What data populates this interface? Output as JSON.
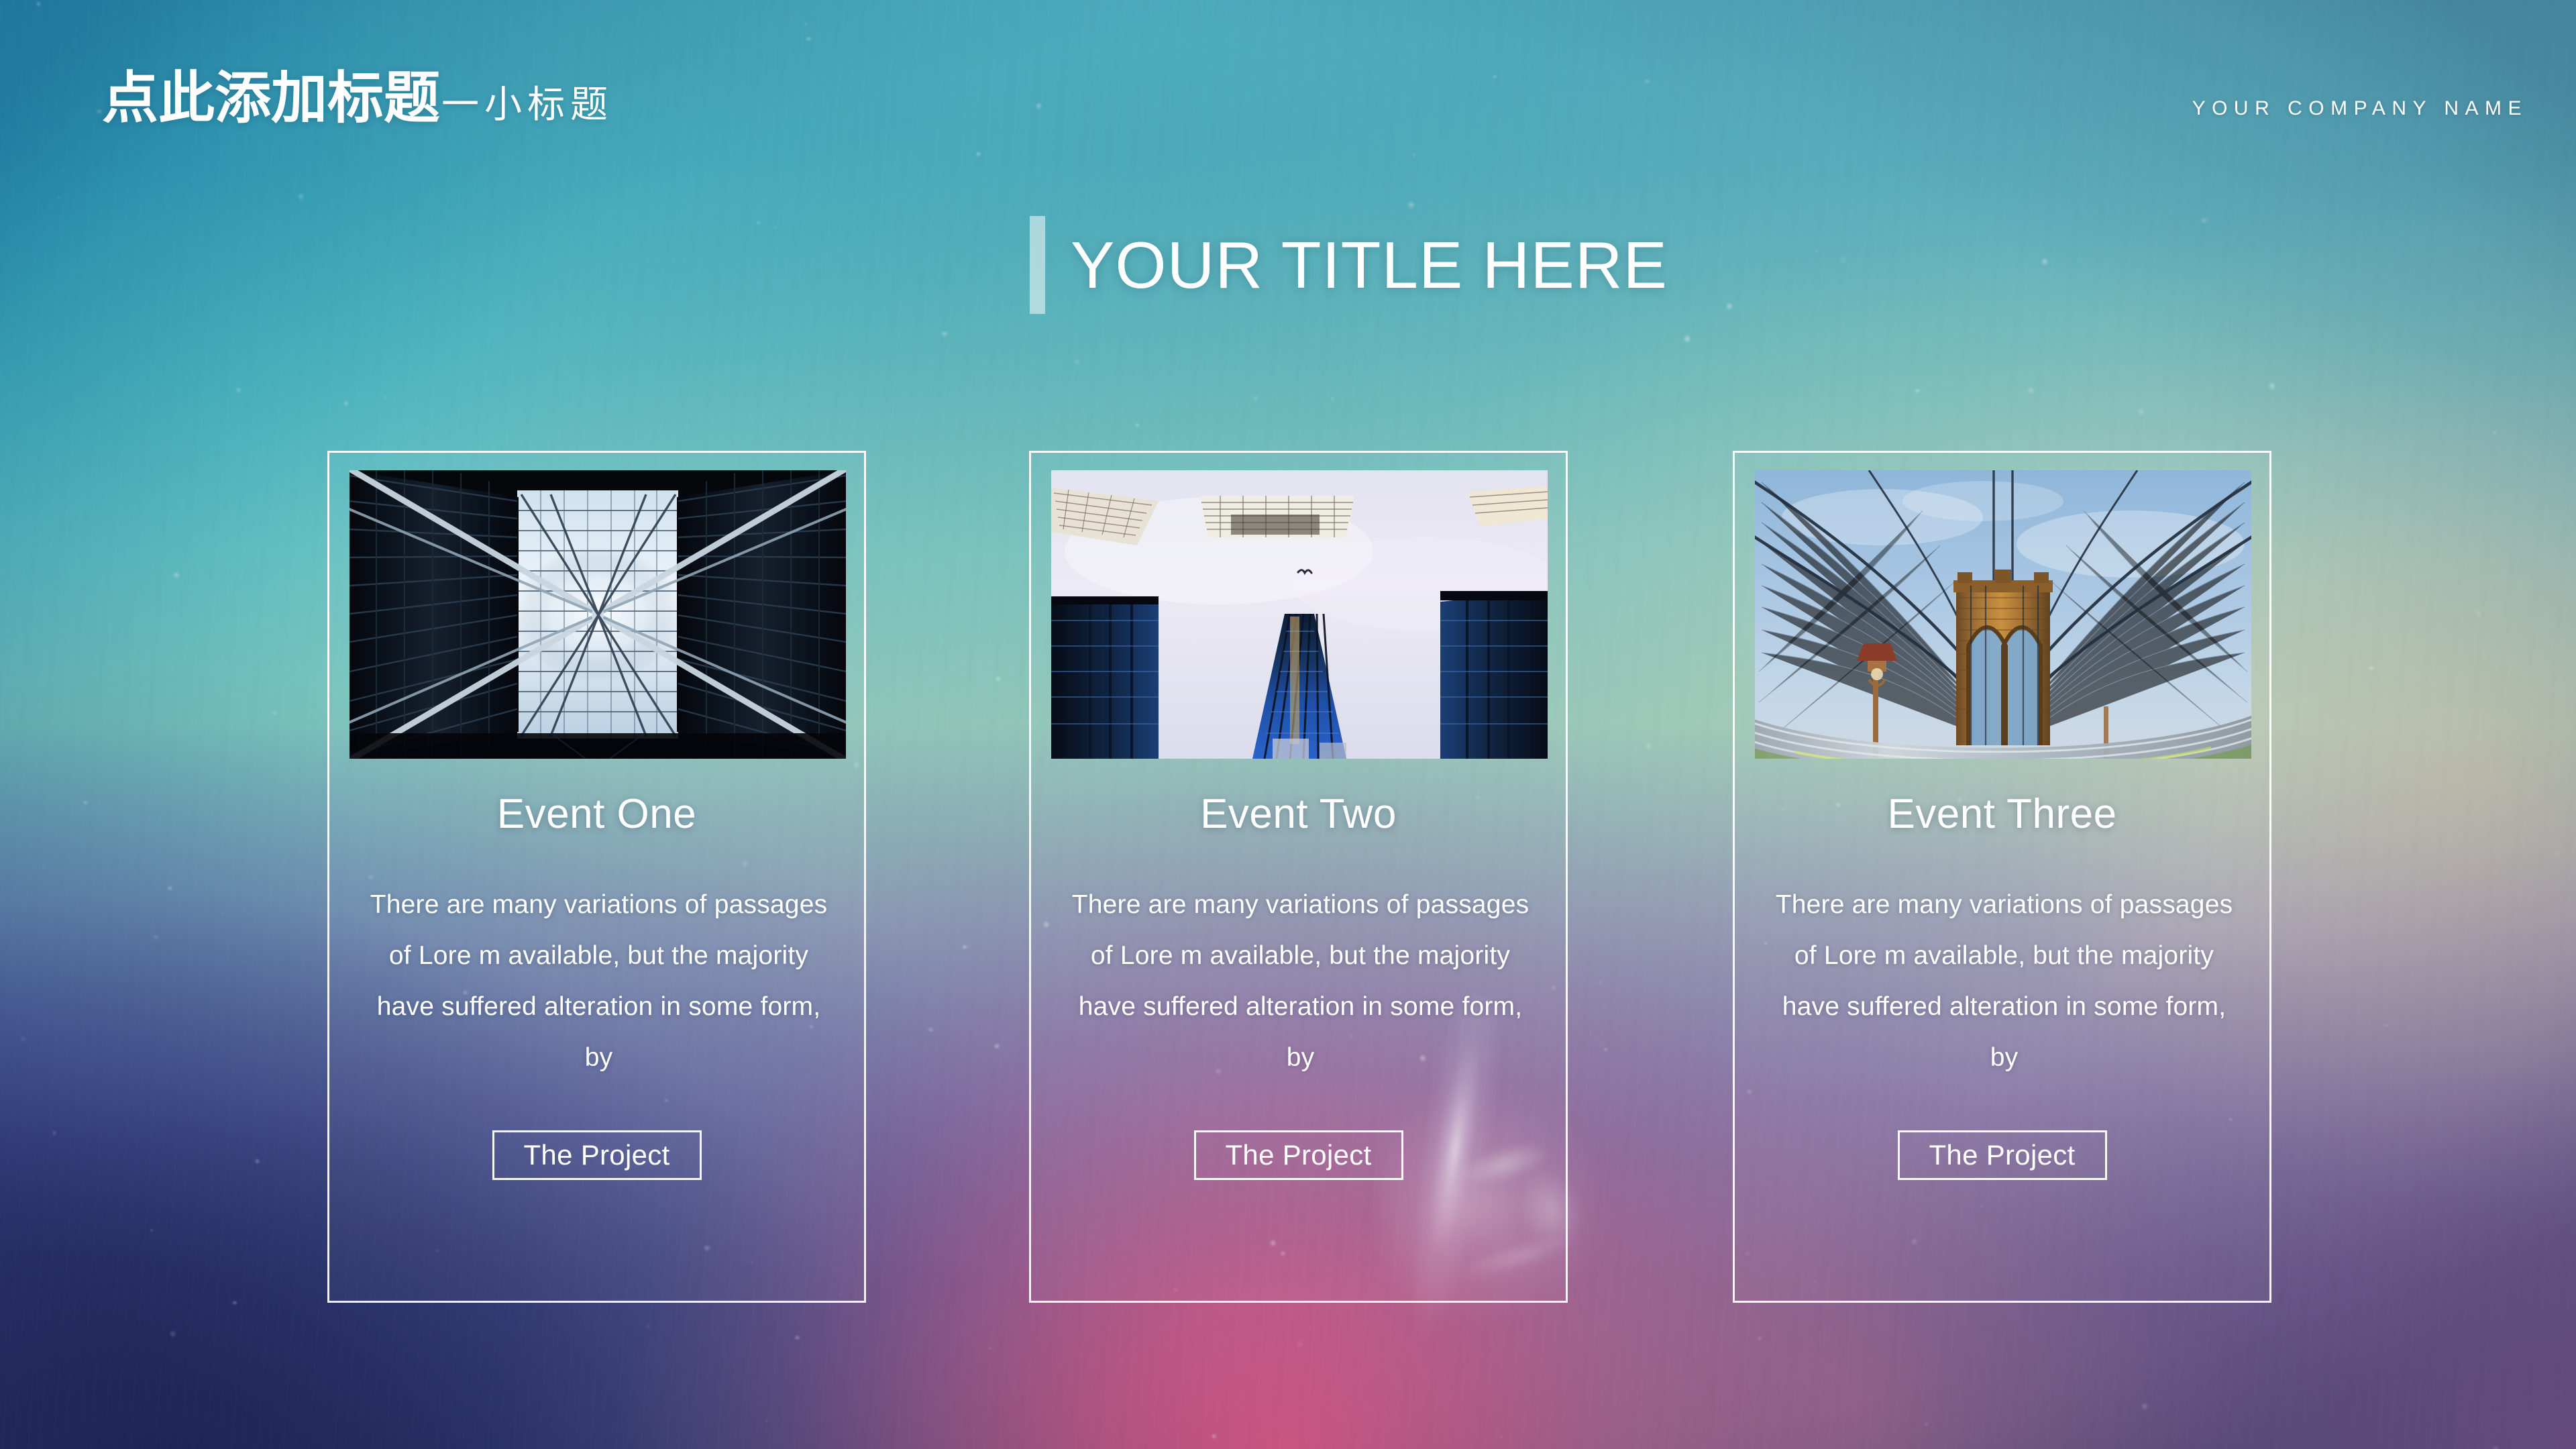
{
  "header": {
    "brand_main": "点此添加标题",
    "brand_sub": "一小标题",
    "company_name": "YOUR COMPANY NAME"
  },
  "section": {
    "title": "YOUR TITLE HERE"
  },
  "cards": [
    {
      "heading": "Event One",
      "body": "There are many variations of passages of Lore m available, but the majority have suffered alteration in some form, by",
      "button_label": "The Project",
      "image_alt": "glass-atrium-looking-up"
    },
    {
      "heading": "Event Two",
      "body": "There are many variations of passages of Lore m available, but the majority have suffered alteration in some form, by",
      "button_label": "The Project",
      "image_alt": "skyscrapers-looking-up"
    },
    {
      "heading": "Event Three",
      "body": "There are many variations of passages of Lore m available, but the majority have suffered alteration in some form, by",
      "button_label": "The Project",
      "image_alt": "brooklyn-bridge-cables"
    }
  ],
  "colors": {
    "text": "#ffffff",
    "bg_top_teal": "#49a6b9",
    "bg_left_navy": "#2a3272",
    "bg_center_rose": "#e0587f",
    "bg_right_mauve": "#8b6096",
    "bg_right_sand": "#dcc8a8",
    "card_border": "rgba(255,255,255,0.92)",
    "accent_bar": "rgba(255,255,255,0.52)"
  }
}
